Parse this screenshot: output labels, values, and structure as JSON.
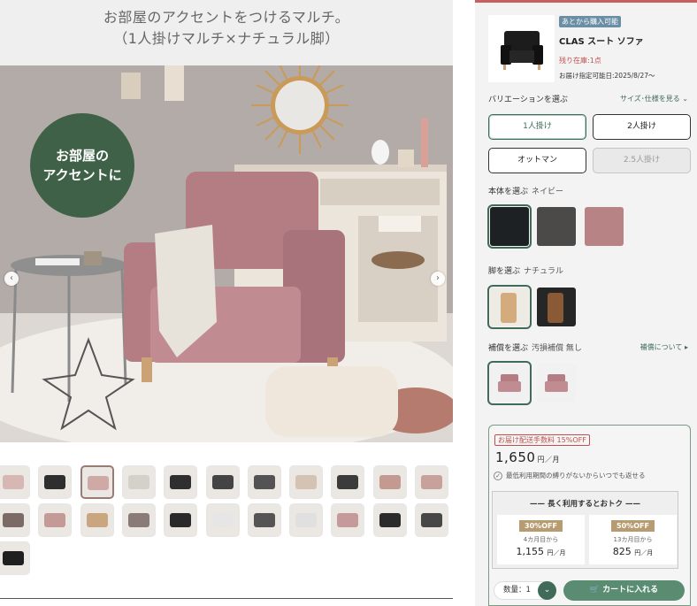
{
  "headline": {
    "line1": "お部屋のアクセントをつけるマルチ。",
    "line2": "（1人掛けマルチ×ナチュラル脚）"
  },
  "hero": {
    "badge_line1": "お部屋の",
    "badge_line2": "アクセントに",
    "prev_icon": "chevron-left-icon",
    "next_icon": "chevron-right-icon"
  },
  "thumbnails": {
    "count": 23,
    "selected_index": 2
  },
  "product": {
    "tag": "あとから購入可能",
    "name": "CLAS スート ソファ",
    "stock": "残り在庫:1点",
    "delivery": "お届け指定可能日:2025/8/27〜"
  },
  "variation": {
    "label": "バリエーションを選ぶ",
    "link": "サイズ･仕様を見る",
    "options": [
      {
        "label": "1人掛け",
        "state": "selected"
      },
      {
        "label": "2人掛け",
        "state": "normal"
      },
      {
        "label": "オットマン",
        "state": "normal"
      },
      {
        "label": "2.5人掛け",
        "state": "disabled"
      }
    ]
  },
  "body_color": {
    "label": "本体を選ぶ",
    "value": "ネイビー",
    "swatches": [
      "#1d2123",
      "#4b4a48",
      "#b88384"
    ]
  },
  "legs": {
    "label": "脚を選ぶ",
    "value": "ナチュラル"
  },
  "compensation": {
    "label": "補償を選ぶ",
    "value": "汚損補償 無し",
    "link": "補償について"
  },
  "pricing": {
    "badge": "お届け配送手数料 15%OFF",
    "price": "1,650",
    "unit": "円／月",
    "note": "最低利用期間の縛りがないからいつでも返せる",
    "deal_title": "長く利用するとおトク",
    "deals": [
      {
        "pill": "30%OFF",
        "sub": "4カ月目から",
        "price": "1,155",
        "unit": "円／月"
      },
      {
        "pill": "50%OFF",
        "sub": "13カ月目から",
        "price": "825",
        "unit": "円／月"
      }
    ]
  },
  "cart": {
    "qty_label": "数量：1",
    "button_label": "カートに入れる"
  },
  "colors": {
    "accent_green": "#3f6b58",
    "cart_green": "#5a8c72",
    "sale_red": "#c0504d",
    "deal_gold": "#b79c71"
  }
}
